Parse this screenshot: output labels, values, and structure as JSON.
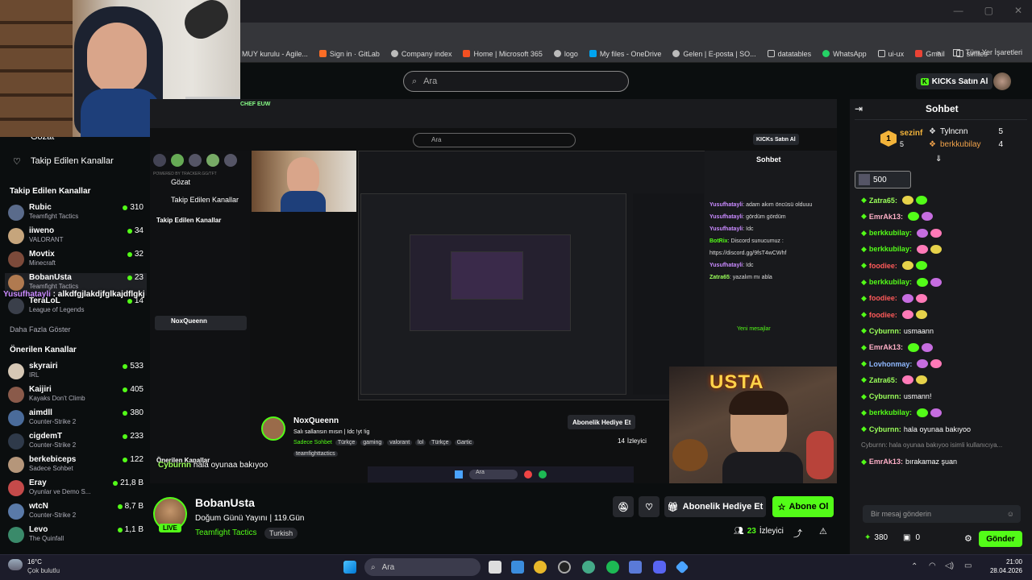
{
  "browser": {
    "bookmarks": [
      {
        "label": "MUY kurulu - Agile..."
      },
      {
        "label": "Sign in · GitLab"
      },
      {
        "label": "Company index"
      },
      {
        "label": "Home | Microsoft 365"
      },
      {
        "label": "logo"
      },
      {
        "label": "My files - OneDrive"
      },
      {
        "label": "Gelen | E-posta | SO..."
      },
      {
        "label": "datatables"
      },
      {
        "label": "WhatsApp"
      },
      {
        "label": "ui-ux"
      },
      {
        "label": "Gmail"
      },
      {
        "label": "simtes"
      }
    ],
    "bookmarks_more": "»",
    "all_bookmarks": "Tüm Yer İşaretleri"
  },
  "header": {
    "search_placeholder": "Ara",
    "buy_kicks": "KICKs Satın Al"
  },
  "sidebar": {
    "browse": "Gözat",
    "followed_link": "Takip Edilen Kanallar",
    "followed_heading": "Takip Edilen Kanallar",
    "followed": [
      {
        "name": "Rubic",
        "game": "Teamfight Tactics",
        "count": "310"
      },
      {
        "name": "iiweno",
        "game": "VALORANT",
        "count": "34"
      },
      {
        "name": "Movtix",
        "game": "Minecraft",
        "count": "32"
      },
      {
        "name": "BobanUsta",
        "game": "Teamfight Tactics",
        "count": "23"
      },
      {
        "name": "TeraLoL",
        "game": "League of Legends",
        "count": "14"
      }
    ],
    "overlay_msg_user": "Yusufhatayli",
    "overlay_msg_text": "alkdfgjlakdjfglkajdflgkj",
    "show_more": "Daha Fazla Göster",
    "recommended_heading": "Önerilen Kanallar",
    "recommended": [
      {
        "name": "skyrairi",
        "game": "IRL",
        "count": "533"
      },
      {
        "name": "Kaijiri",
        "game": "Kayaks Don't Climb",
        "count": "405"
      },
      {
        "name": "aimdll",
        "game": "Counter-Strike 2",
        "count": "380"
      },
      {
        "name": "cigdemT",
        "game": "Counter-Strike 2",
        "count": "233"
      },
      {
        "name": "berkebiceps",
        "game": "Sadece Sohbet",
        "count": "122"
      },
      {
        "name": "Eray",
        "game": "Oyunlar ve Demo S...",
        "count": "21,8 B"
      },
      {
        "name": "wtcN",
        "game": "Counter-Strike 2",
        "count": "8,7 B"
      },
      {
        "name": "Levo",
        "game": "The Quinfall",
        "count": "1,1 B"
      }
    ]
  },
  "stream": {
    "nested_channel": "NoxQueenn",
    "nested_title": "Salı sallansın mısın | Idc !yt !ig",
    "nested_category": "Sadece Sohbet",
    "nested_tags": [
      "Türkçe",
      "gaming",
      "valorant",
      "lol",
      "Türkçe",
      "Gartic"
    ],
    "nested_tag2": "teamfighttactics",
    "nested_subscribe": "Abonelik Hediye Et",
    "nested_viewers": "14",
    "nested_viewers_label": "İzleyici",
    "nested_chat_title": "Sohbet",
    "nested_chat": [
      {
        "user": "Yusufhatayli",
        "text": "adam akım öncüsü olduuu"
      },
      {
        "user": "Yusufhatayli",
        "text": "gördüm gördüm"
      },
      {
        "user": "Yusufhatayli",
        "text": "Idc"
      },
      {
        "user": "BotRix",
        "text": "Discord sunucumuz : https://discord.gg/9fsT4wCWhf"
      },
      {
        "user": "Yusufhatayli",
        "text": "Idc"
      },
      {
        "user": "Zatra65",
        "text": "yazalım mı abla"
      }
    ],
    "new_messages": "Yeni mesajlar",
    "overlay_chat_user": "Cyburnn",
    "overlay_chat_text": "hala oyunaa bakıyoo",
    "cam_label": "USTA",
    "brand_overlay": "CHEF EUW",
    "powered": "POWERED BY TRACKER.GG/TFT"
  },
  "channel": {
    "name": "BobanUsta",
    "live": "LIVE",
    "title": "Doğum Günü Yayını | 119.Gün",
    "category": "Teamfight Tactics",
    "tag": "Turkish",
    "gift_sub": "Abonelik Hediye Et",
    "subscribe": "Abone Ol",
    "viewers": "23",
    "viewers_label": "İzleyici"
  },
  "chat": {
    "title": "Sohbet",
    "leaders": [
      {
        "name": "sezinf",
        "score": "5"
      },
      {
        "name": "Tylncnn",
        "score": "5"
      },
      {
        "name": "berkkubilay",
        "score": "4"
      }
    ],
    "rank": "1",
    "pinned_value": "500",
    "messages": [
      {
        "user": "Zatra65:",
        "text": "",
        "color": "#9aff5a"
      },
      {
        "user": "EmrAk13:",
        "text": "",
        "color": "#ffb0c8"
      },
      {
        "user": "berkkubilay:",
        "text": "",
        "color": "#53fc18"
      },
      {
        "user": "berkkubilay:",
        "text": "",
        "color": "#53fc18"
      },
      {
        "user": "foodiee:",
        "text": "",
        "color": "#ff5a5a"
      },
      {
        "user": "berkkubilay:",
        "text": "",
        "color": "#53fc18"
      },
      {
        "user": "foodiee:",
        "text": "",
        "color": "#ff5a5a"
      },
      {
        "user": "foodiee:",
        "text": "",
        "color": "#ff5a5a"
      },
      {
        "user": "Cyburnn:",
        "text": "usmaann",
        "color": "#9aff5a"
      },
      {
        "user": "EmrAk13:",
        "text": "",
        "color": "#ffb0c8"
      },
      {
        "user": "Lovhonmay:",
        "text": "",
        "color": "#8fb8ff"
      },
      {
        "user": "Zatra65:",
        "text": "",
        "color": "#9aff5a"
      },
      {
        "user": "Cyburnn:",
        "text": "usmann!",
        "color": "#9aff5a"
      },
      {
        "user": "berkkubilay:",
        "text": "",
        "color": "#53fc18"
      },
      {
        "user": "Cyburnn:",
        "text": "hala oyunaa bakıyoo",
        "color": "#9aff5a"
      },
      {
        "user": "",
        "text": "Cyburnn: hala oyunaa bakıyoo isimli kullanıcıya...",
        "color": "#888"
      },
      {
        "user": "EmrAk13:",
        "text": "bırakamaz şuan",
        "color": "#ffb0c8"
      }
    ],
    "input_placeholder": "Bir mesaj gönderin",
    "points": "380",
    "gifts": "0",
    "send": "Gönder"
  },
  "taskbar": {
    "weather_temp": "16°C",
    "weather_desc": "Çok bulutlu",
    "search": "Ara",
    "time": "21:00",
    "date": "28.04.2026"
  },
  "colors": {
    "accent": "#53fc18",
    "bg": "#0b0e0f",
    "panel": "#18191c"
  }
}
